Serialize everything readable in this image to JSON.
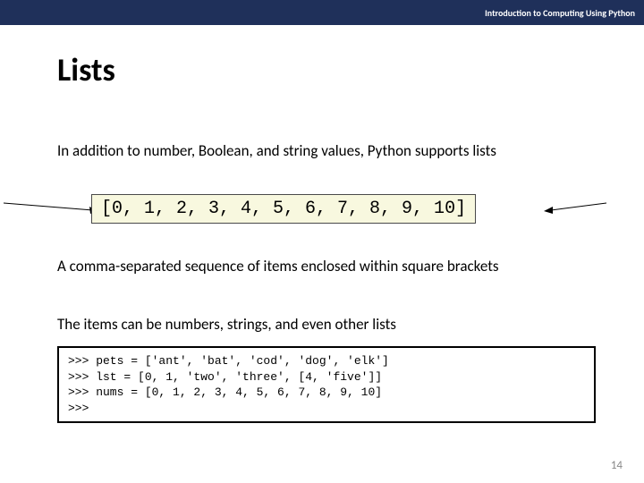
{
  "header": "Introduction to Computing Using Python",
  "title": "Lists",
  "intro": "In addition to number, Boolean, and string values, Python supports lists",
  "list_example": "[0, 1, 2, 3, 4, 5, 6, 7, 8, 9, 10]",
  "desc": "A comma-separated sequence of items enclosed within square brackets",
  "desc2": "The items can be numbers, strings, and even other lists",
  "code": ">>> pets = ['ant', 'bat', 'cod', 'dog', 'elk']\n>>> lst = [0, 1, 'two', 'three', [4, 'five']]\n>>> nums = [0, 1, 2, 3, 4, 5, 6, 7, 8, 9, 10]\n>>> ",
  "page_number": "14"
}
